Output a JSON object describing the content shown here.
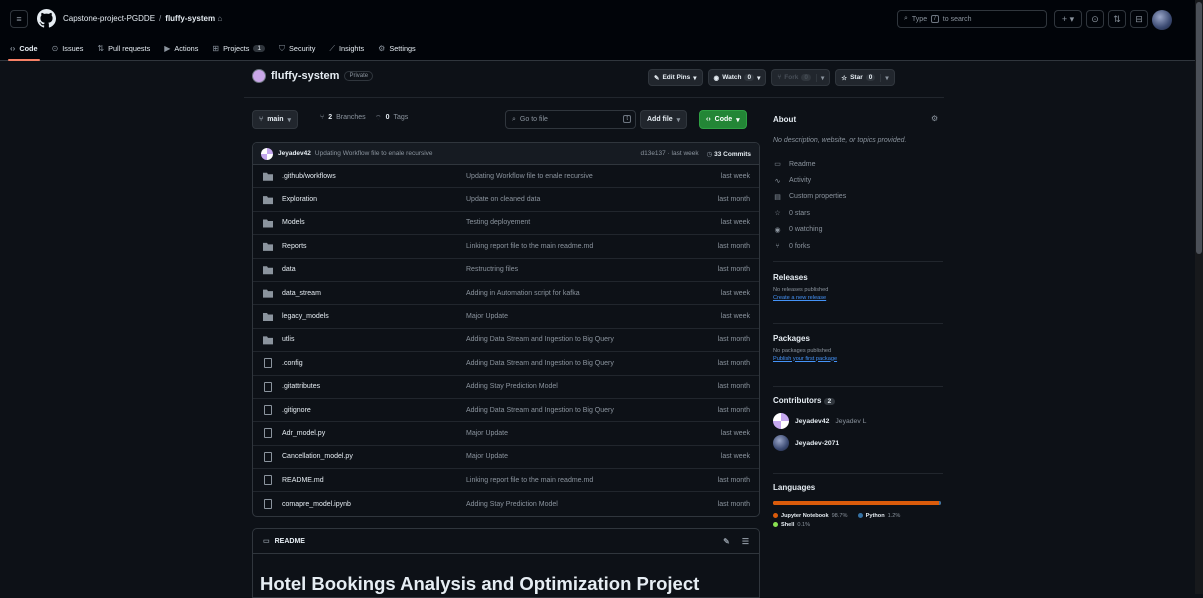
{
  "topbar": {
    "owner": "Capstone-project-PGDDE",
    "repo": "fluffy-system",
    "search_placeholder": "Type",
    "search_key": "/",
    "search_suffix": "to search"
  },
  "subnav": [
    {
      "label": "Code",
      "icon": "code-icon",
      "active": true
    },
    {
      "label": "Issues",
      "icon": "issue-icon"
    },
    {
      "label": "Pull requests",
      "icon": "pull-request-icon"
    },
    {
      "label": "Actions",
      "icon": "actions-icon"
    },
    {
      "label": "Projects",
      "icon": "projects-icon",
      "count": "1"
    },
    {
      "label": "Security",
      "icon": "shield-icon"
    },
    {
      "label": "Insights",
      "icon": "graph-icon"
    },
    {
      "label": "Settings",
      "icon": "gear-icon"
    }
  ],
  "repo": {
    "name": "fluffy-system",
    "visibility": "Private",
    "edit_pins": "Edit Pins",
    "watch": "Watch",
    "watch_count": "0",
    "fork": "Fork",
    "fork_count": "0",
    "star": "Star",
    "star_count": "0"
  },
  "toolbar": {
    "branch": "main",
    "branches_count": "2",
    "branches_label": "Branches",
    "tags_count": "0",
    "tags_label": "Tags",
    "goto_placeholder": "Go to file",
    "goto_key": "t",
    "add_file": "Add file",
    "code": "Code"
  },
  "latest_commit": {
    "author": "Jeyadev42",
    "message": "Updating Workflow file to enale recursive",
    "sha_time": "d13e137 · last week",
    "commits": "33 Commits"
  },
  "files": [
    {
      "type": "folder",
      "name": ".github/workflows",
      "commit": "Updating Workflow file to enale recursive",
      "date": "last week"
    },
    {
      "type": "folder",
      "name": "Exploration",
      "commit": "Update on cleaned data",
      "date": "last month"
    },
    {
      "type": "folder",
      "name": "Models",
      "commit": "Testing deployement",
      "date": "last week"
    },
    {
      "type": "folder",
      "name": "Reports",
      "commit": "Linking report file to the main readme.md",
      "date": "last month"
    },
    {
      "type": "folder",
      "name": "data",
      "commit": "Restructring files",
      "date": "last month"
    },
    {
      "type": "folder",
      "name": "data_stream",
      "commit": "Adding in Automation script for kafka",
      "date": "last week"
    },
    {
      "type": "folder",
      "name": "legacy_models",
      "commit": "Major Update",
      "date": "last week"
    },
    {
      "type": "folder",
      "name": "utlis",
      "commit": "Adding Data Stream and Ingestion to Big Query",
      "date": "last month"
    },
    {
      "type": "file",
      "name": ".config",
      "commit": "Adding Data Stream and Ingestion to Big Query",
      "date": "last month"
    },
    {
      "type": "file",
      "name": ".gitattributes",
      "commit": "Adding Stay Prediction Model",
      "date": "last month"
    },
    {
      "type": "file",
      "name": ".gitignore",
      "commit": "Adding Data Stream and Ingestion to Big Query",
      "date": "last month"
    },
    {
      "type": "file",
      "name": "Adr_model.py",
      "commit": "Major Update",
      "date": "last week"
    },
    {
      "type": "file",
      "name": "Cancellation_model.py",
      "commit": "Major Update",
      "date": "last week"
    },
    {
      "type": "file",
      "name": "README.md",
      "commit": "Linking report file to the main readme.md",
      "date": "last month"
    },
    {
      "type": "file",
      "name": "comapre_model.ipynb",
      "commit": "Adding Stay Prediction Model",
      "date": "last month"
    }
  ],
  "readme": {
    "tab": "README",
    "heading": "Hotel Bookings Analysis and Optimization Project"
  },
  "about": {
    "title": "About",
    "description": "No description, website, or topics provided.",
    "items": [
      {
        "icon": "book-icon",
        "label": "Readme"
      },
      {
        "icon": "pulse-icon",
        "label": "Activity"
      },
      {
        "icon": "note-icon",
        "label": "Custom properties"
      },
      {
        "icon": "star-icon",
        "label": "0 stars"
      },
      {
        "icon": "eye-icon",
        "label": "0 watching"
      },
      {
        "icon": "fork-icon",
        "label": "0 forks"
      }
    ]
  },
  "releases": {
    "title": "Releases",
    "text": "No releases published",
    "link": "Create a new release"
  },
  "packages": {
    "title": "Packages",
    "text": "No packages published",
    "link": "Publish your first package"
  },
  "contributors": {
    "title": "Contributors",
    "count": "2",
    "people": [
      {
        "login": "Jeyadev42",
        "name": "Jeyadev L"
      },
      {
        "login": "Jeyadev-2071",
        "name": ""
      }
    ]
  },
  "languages": {
    "title": "Languages",
    "items": [
      {
        "name": "Jupyter Notebook",
        "pct": "98.7%",
        "share": 98.7,
        "color": "#DA5B0B"
      },
      {
        "name": "Python",
        "pct": "1.2%",
        "share": 1.2,
        "color": "#3572A5"
      },
      {
        "name": "Shell",
        "pct": "0.1%",
        "share": 0.1,
        "color": "#89e051"
      }
    ]
  }
}
